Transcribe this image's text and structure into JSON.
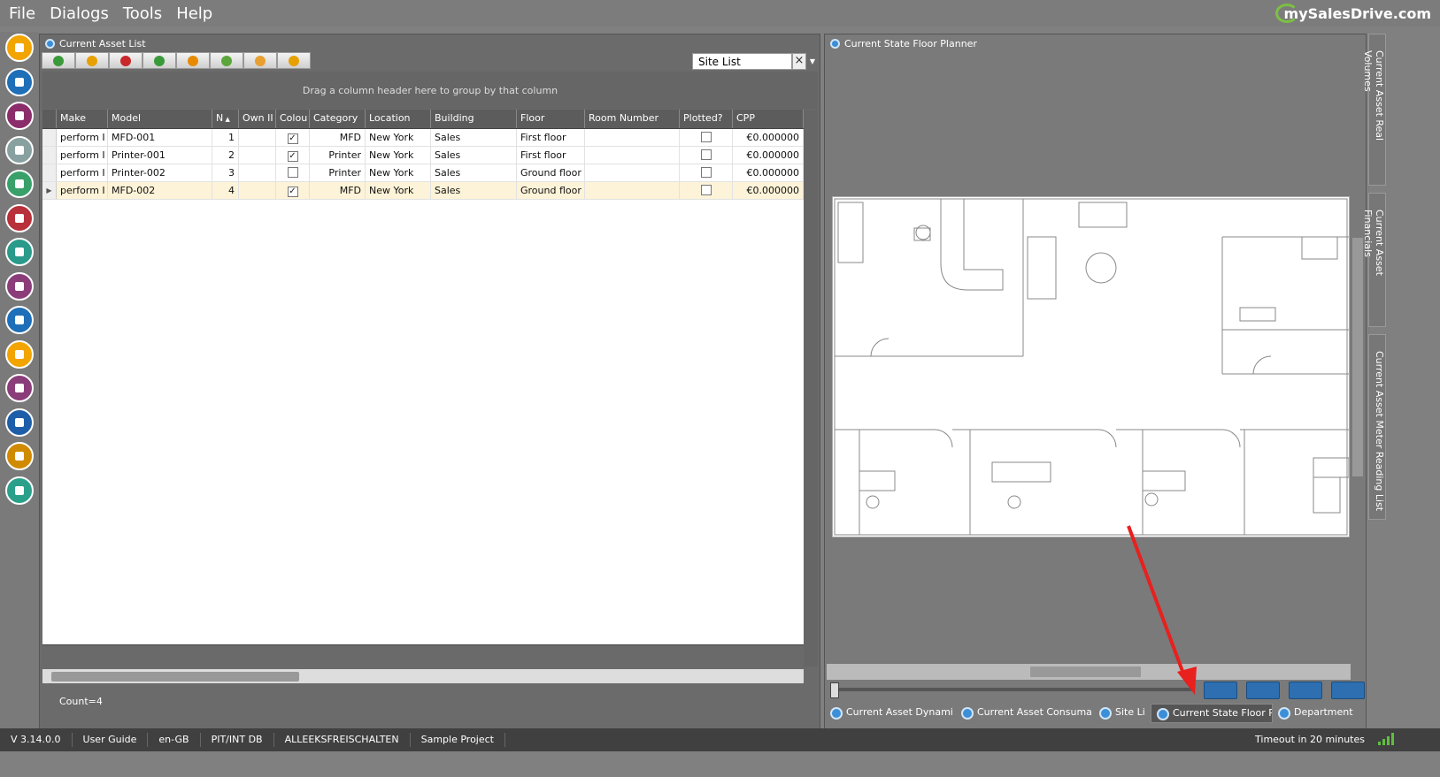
{
  "menu": {
    "file": "File",
    "dialogs": "Dialogs",
    "tools": "Tools",
    "help": "Help"
  },
  "brand": "mySalesDrive.com",
  "left_panel": {
    "title": "Current Asset List",
    "site_list_value": "Site List",
    "site_list_clear": "×",
    "group_hint": "Drag a column header here to group by that column",
    "columns": [
      "Make",
      "Model",
      "N",
      "Own II",
      "Colou",
      "Category",
      "Location",
      "Building",
      "Floor",
      "Room Number",
      "Plotted?",
      "CPP"
    ],
    "rows": [
      {
        "make": "perform I",
        "model": "MFD-001",
        "n": "1",
        "own": "",
        "colour": "✓",
        "category": "MFD",
        "location": "New York",
        "building": "Sales",
        "floor": "First floor",
        "room": "",
        "plotted": "",
        "cpp": "€0.000000"
      },
      {
        "make": "perform I",
        "model": "Printer-001",
        "n": "2",
        "own": "",
        "colour": "✓",
        "category": "Printer",
        "location": "New York",
        "building": "Sales",
        "floor": "First floor",
        "room": "",
        "plotted": "",
        "cpp": "€0.000000"
      },
      {
        "make": "perform I",
        "model": "Printer-002",
        "n": "3",
        "own": "",
        "colour": "",
        "category": "Printer",
        "location": "New York",
        "building": "Sales",
        "floor": "Ground floor",
        "room": "",
        "plotted": "",
        "cpp": "€0.000000"
      },
      {
        "make": "perform I",
        "model": "MFD-002",
        "n": "4",
        "own": "",
        "colour": "✓",
        "category": "MFD",
        "location": "New York",
        "building": "Sales",
        "floor": "Ground floor",
        "room": "",
        "plotted": "",
        "cpp": "€0.000000"
      }
    ],
    "count": "Count=4"
  },
  "right_panel": {
    "title": "Current State Floor Planner",
    "tabs": [
      "Current Asset Dynami",
      "Current Asset Consuma",
      "Site Li",
      "Current State Floor P",
      "Department"
    ]
  },
  "vertical_tabs": [
    "Current Asset Real Volumes",
    "Current Asset Financials",
    "Current Asset Meter Reading List"
  ],
  "status": {
    "version": "V 3.14.0.0",
    "guide": "User Guide",
    "locale": "en-GB",
    "db": "PIT/INT DB",
    "unlock": "ALLEEKSFREISCHALTEN",
    "project": "Sample Project",
    "timeout": "Timeout in 20 minutes"
  },
  "sidebar_icons": [
    "home-icon",
    "folder-icon",
    "hierarchy-icon",
    "binoculars-icon",
    "scroll-icon",
    "chart-icon",
    "trend-icon",
    "eye-icon",
    "target-icon",
    "handshake-icon",
    "bar-chart-icon",
    "document-icon",
    "briefcase-icon",
    "database-icon"
  ],
  "sidebar_colors": [
    "#f2a400",
    "#1e6fb8",
    "#8b2d6b",
    "#88a0a0",
    "#3aa06a",
    "#b8303a",
    "#2a9a8a",
    "#8b3d7a",
    "#1e6fb8",
    "#f2a400",
    "#8b3d7a",
    "#1e5ea8",
    "#d08a00",
    "#2aa08a"
  ]
}
